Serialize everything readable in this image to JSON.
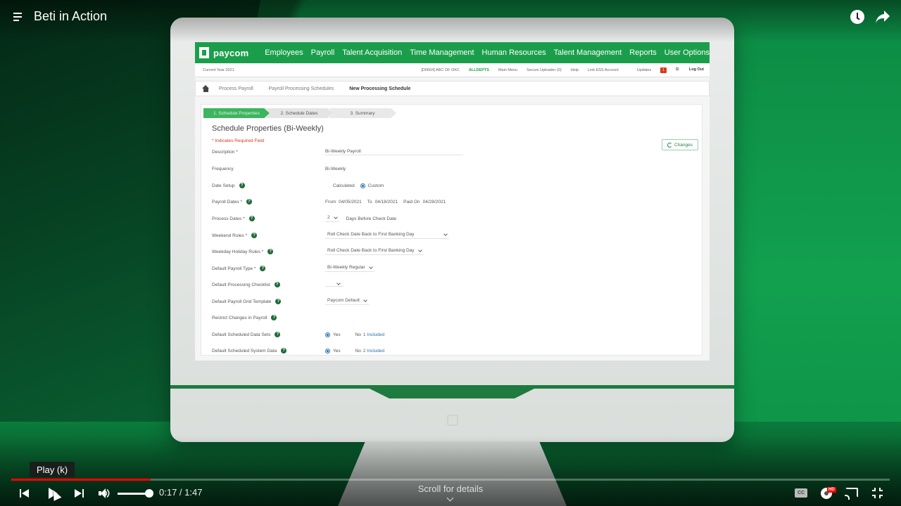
{
  "video": {
    "title": "Beti in Action",
    "tooltip": "Play (k)",
    "time": "0:17 / 1:47",
    "progress_fraction": 0.159,
    "scroll_hint": "Scroll for details",
    "cc_label": "CC",
    "hd_label": "HD",
    "accent_color": "#ff0000"
  },
  "app": {
    "brand": "paycom",
    "brand_color": "#1b9e4b",
    "nav": [
      "Employees",
      "Payroll",
      "Talent Acquisition",
      "Time Management",
      "Human Resources",
      "Talent Management",
      "Reports",
      "User Options"
    ],
    "subbar": {
      "year": "Current Year 2021",
      "company_code": "[D0664] ABC OF OKC",
      "company": "ALLDEPTS",
      "links": [
        "Main Menu",
        "Secure Uploader (0)",
        "Help",
        "Link ESS Account",
        "Updates"
      ],
      "updates_count": "1",
      "logout": "Log Out"
    },
    "breadcrumb": [
      "Process Payroll",
      "Payroll Processing Schedules",
      "New Processing Schedule"
    ],
    "steps": [
      "1. Schedule Properties",
      "2. Schedule Dates",
      "3. Summary"
    ],
    "form": {
      "title": "Schedule Properties (Bi-Weekly)",
      "required_note": "* Indicates Required Field",
      "changes_button": "Changes",
      "description_label": "Description *",
      "description_value": "Bi-Weekly Payroll",
      "frequency_label": "Frequency",
      "frequency_value": "Bi-Weekly",
      "date_setup_label": "Date Setup",
      "date_setup_calculated": "Calculated",
      "date_setup_custom": "Custom",
      "payroll_dates_label": "Payroll Dates *",
      "from_label": "From",
      "from_value": "04/05/2021",
      "to_label": "To",
      "to_value": "04/18/2021",
      "paid_on_label": "Paid On",
      "paid_on_value": "04/28/2021",
      "process_dates_label": "Process  Dates *",
      "process_dates_value": "2",
      "process_dates_suffix": "Days Before Check Date",
      "weekend_rules_label": "Weekend Rules *",
      "weekend_rules_value": "Roll Check Date Back to First Banking Day",
      "weekday_holiday_label": "Weekday Holiday Rules *",
      "weekday_holiday_value": "Roll Check Date Back to First Banking Day",
      "default_type_label": "Default Payroll Type *",
      "default_type_value": "Bi-Weekly Regular",
      "checklist_label": "Default Processing Checklist",
      "checklist_value": "",
      "grid_template_label": "Default Payroll Grid Template",
      "grid_template_value": "Paycom Default",
      "restrict_label": "Restrict Changes in Payroll",
      "data_sets_label": "Default Scheduled Data Sets",
      "data_sets_yes": "Yes",
      "data_sets_no": "No",
      "data_sets_count": "1",
      "data_sets_included": "Included",
      "system_data_label": "Default Scheduled System Data",
      "system_data_yes": "Yes",
      "system_data_no": "No",
      "system_data_count": "2",
      "system_data_included": "Included",
      "help_glyph": "?"
    }
  }
}
